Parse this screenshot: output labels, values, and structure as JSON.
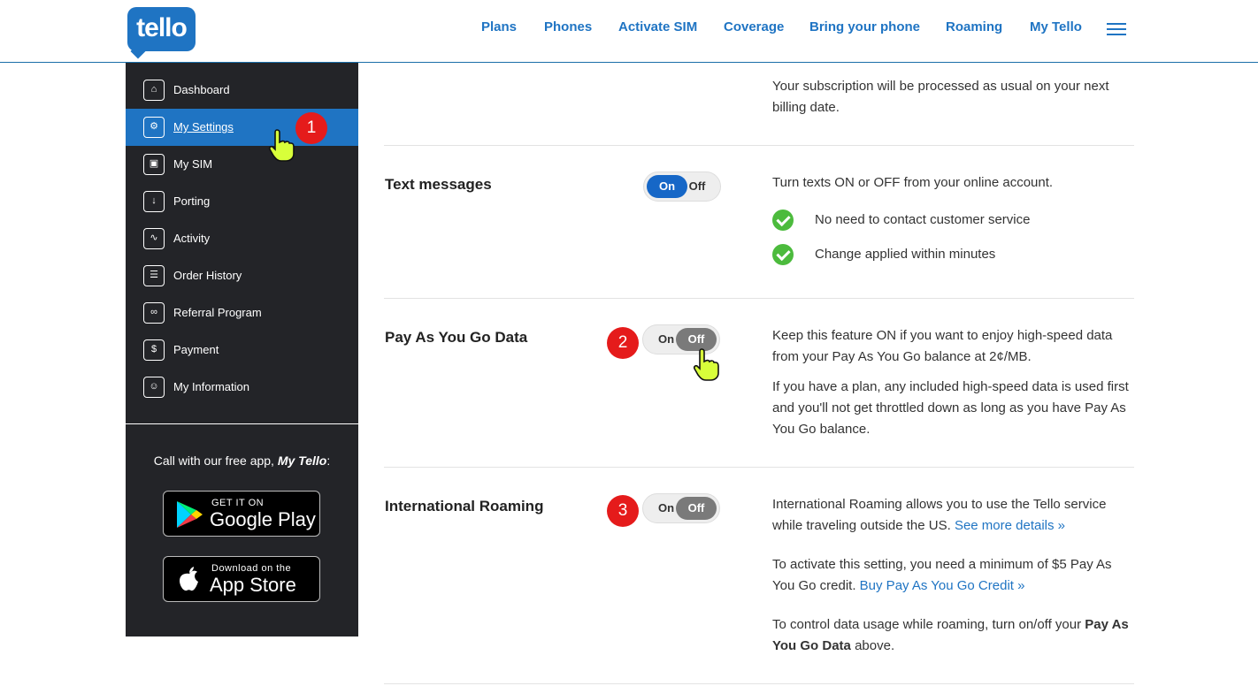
{
  "header": {
    "logo_text": "tello",
    "nav": [
      "Plans",
      "Phones",
      "Activate SIM",
      "Coverage",
      "Bring your phone",
      "Roaming",
      "My Tello"
    ]
  },
  "sidebar": {
    "items": [
      {
        "label": "Dashboard",
        "icon": "dashboard-icon"
      },
      {
        "label": "My Settings",
        "icon": "settings-icon"
      },
      {
        "label": "My SIM",
        "icon": "sim-icon"
      },
      {
        "label": "Porting",
        "icon": "porting-icon"
      },
      {
        "label": "Activity",
        "icon": "activity-icon"
      },
      {
        "label": "Order History",
        "icon": "order-history-icon"
      },
      {
        "label": "Referral Program",
        "icon": "referral-icon"
      },
      {
        "label": "Payment",
        "icon": "payment-icon"
      },
      {
        "label": "My Information",
        "icon": "user-icon"
      }
    ],
    "promo_prefix": "Call with our free app, ",
    "promo_app": "My Tello",
    "promo_suffix": ":",
    "google_small": "GET IT ON",
    "google_big": "Google Play",
    "apple_small": "Download on the",
    "apple_big": "App Store"
  },
  "badges": {
    "one": "1",
    "two": "2",
    "three": "3"
  },
  "content": {
    "top_partial": "Your subscription will be processed as usual on your next billing date.",
    "text_messages": {
      "title": "Text messages",
      "on": "On",
      "off": "Off",
      "state": "on",
      "desc": "Turn texts ON or OFF from your online account.",
      "check1": "No need to contact customer service",
      "check2": "Change applied within minutes"
    },
    "payg": {
      "title": "Pay As You Go Data",
      "on": "On",
      "off": "Off",
      "state": "off",
      "desc1": "Keep this feature ON if you want to enjoy high-speed data from your Pay As You Go balance at 2¢/MB.",
      "desc2": "If you have a plan, any included high-speed data is used first and you'll not get throttled down as long as you have Pay As You Go balance."
    },
    "roaming": {
      "title": "International Roaming",
      "on": "On",
      "off": "Off",
      "state": "off",
      "desc1": "International Roaming allows you to use the Tello service while traveling outside the US. ",
      "link1": "See more details »",
      "desc2": "To activate this setting, you need a minimum of $5 Pay As You Go credit. ",
      "link2": "Buy Pay As You Go Credit »",
      "desc3_prefix": "To control data usage while roaming, turn on/off your ",
      "desc3_bold": "Pay As You Go Data",
      "desc3_suffix": " above."
    }
  },
  "colors": {
    "brand": "#1f74c3",
    "sidebar": "#232428",
    "badge": "#e51b1b",
    "check": "#4cbb3d"
  }
}
